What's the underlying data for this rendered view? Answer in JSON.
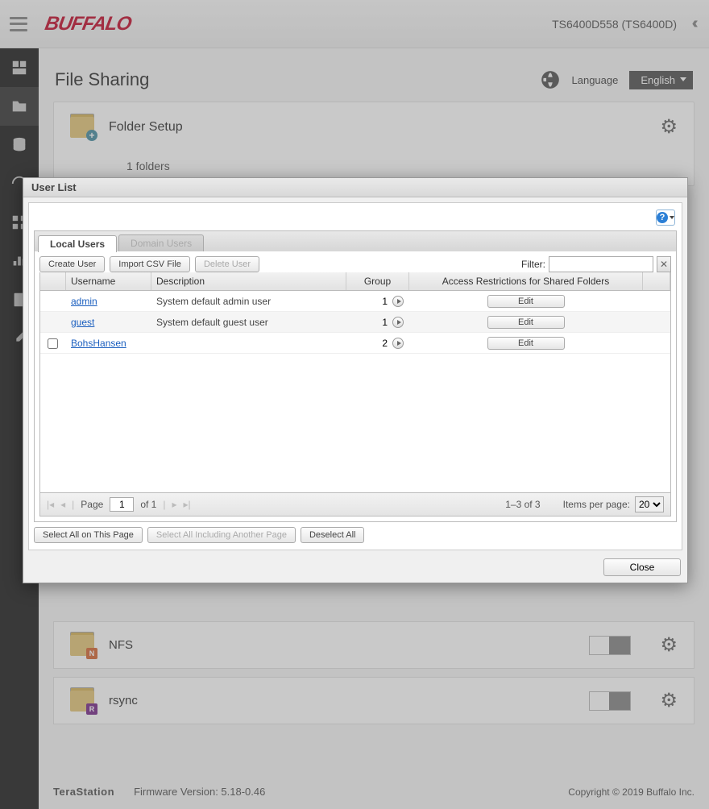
{
  "header": {
    "logo_text": "BUFFALO",
    "device_label": "TS6400D558 (TS6400D)"
  },
  "page": {
    "title": "File Sharing",
    "language_label": "Language",
    "language_value": "English"
  },
  "folder_card": {
    "title": "Folder Setup",
    "sub": "1 folders"
  },
  "services": [
    {
      "name": "NFS",
      "badge": "N",
      "badge_color": "#d66b3a"
    },
    {
      "name": "rsync",
      "badge": "R",
      "badge_color": "#7a2e8c"
    }
  ],
  "footer": {
    "brand": "TeraStation",
    "firmware": "Firmware Version: 5.18-0.46",
    "copyright": "Copyright © 2019 Buffalo Inc."
  },
  "modal": {
    "title": "User List",
    "tabs": {
      "local": "Local Users",
      "domain": "Domain Users"
    },
    "toolbar": {
      "create": "Create User",
      "import": "Import CSV File",
      "delete": "Delete User",
      "filter_label": "Filter:"
    },
    "columns": {
      "username": "Username",
      "description": "Description",
      "group": "Group",
      "access": "Access Restrictions for Shared Folders"
    },
    "rows": [
      {
        "username": "admin",
        "description": "System default admin user",
        "group_count": "1",
        "selectable": false
      },
      {
        "username": "guest",
        "description": "System default guest user",
        "group_count": "1",
        "selectable": false
      },
      {
        "username": "BohsHansen",
        "description": "",
        "group_count": "2",
        "selectable": true
      }
    ],
    "edit_label": "Edit",
    "pager": {
      "page_label": "Page",
      "page_value": "1",
      "of_label": "of 1",
      "range": "1–3 of 3",
      "ipp_label": "Items per page:",
      "ipp_value": "20"
    },
    "selection": {
      "select_page": "Select All on This Page",
      "select_all": "Select All Including Another Page",
      "deselect": "Deselect All"
    },
    "close": "Close"
  }
}
